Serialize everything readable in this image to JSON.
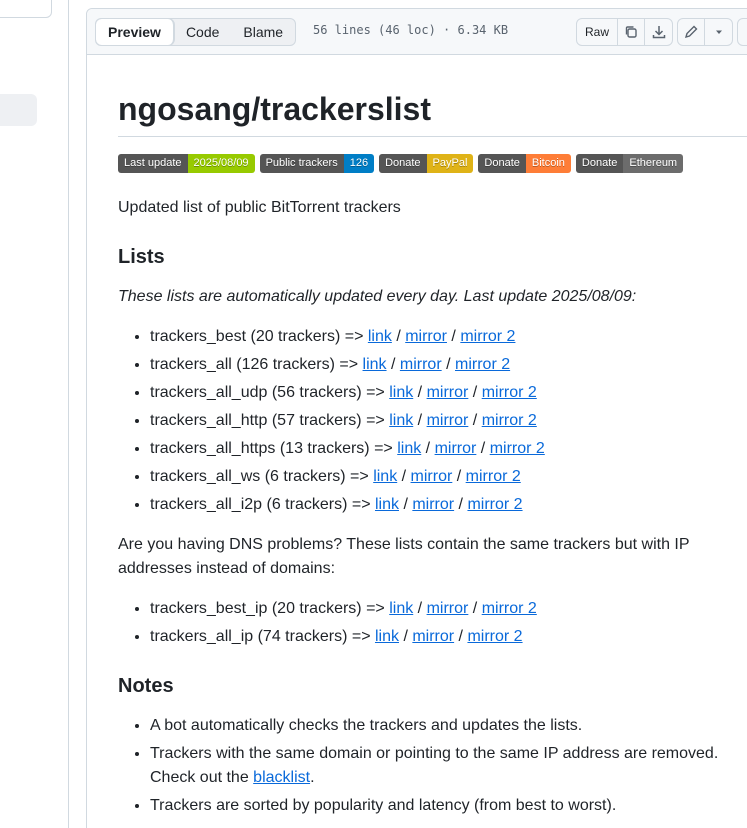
{
  "toolbar": {
    "tabs": [
      "Preview",
      "Code",
      "Blame"
    ],
    "file_meta": "56 lines (46 loc) · 6.34 KB",
    "raw_label": "Raw"
  },
  "readme": {
    "title": "ngosang/trackerslist",
    "badges": [
      {
        "label": "Last update",
        "value": "2025/08/09",
        "color": "#97ca00"
      },
      {
        "label": "Public trackers",
        "value": "126",
        "color": "#007ec6"
      },
      {
        "label": "Donate",
        "value": "PayPal",
        "color": "#dfb317"
      },
      {
        "label": "Donate",
        "value": "Bitcoin",
        "color": "#fe7d37"
      },
      {
        "label": "Donate",
        "value": "Ethereum",
        "color": "#6c6c6c"
      }
    ],
    "intro": "Updated list of public BitTorrent trackers",
    "lists_heading": "Lists",
    "lists_note": "These lists are automatically updated every day. Last update 2025/08/09:",
    "lists": [
      "trackers_best (20 trackers) => ",
      "trackers_all (126 trackers) => ",
      "trackers_all_udp (56 trackers) => ",
      "trackers_all_http (57 trackers) => ",
      "trackers_all_https (13 trackers) => ",
      "trackers_all_ws (6 trackers) => ",
      "trackers_all_i2p (6 trackers) => "
    ],
    "link_labels": [
      "link",
      "mirror",
      "mirror 2"
    ],
    "dns_text": "Are you having DNS problems? These lists contain the same trackers but with IP addresses instead of domains:",
    "ip_lists": [
      "trackers_best_ip (20 trackers) => ",
      "trackers_all_ip (74 trackers) => "
    ],
    "notes_heading": "Notes",
    "notes": [
      {
        "text": "A bot automatically checks the trackers and updates the lists."
      },
      {
        "text": "Trackers with the same domain or pointing to the same IP address are removed. Check out the ",
        "link": "blacklist",
        "after": "."
      },
      {
        "text": "Trackers are sorted by popularity and latency (from best to worst)."
      }
    ]
  }
}
